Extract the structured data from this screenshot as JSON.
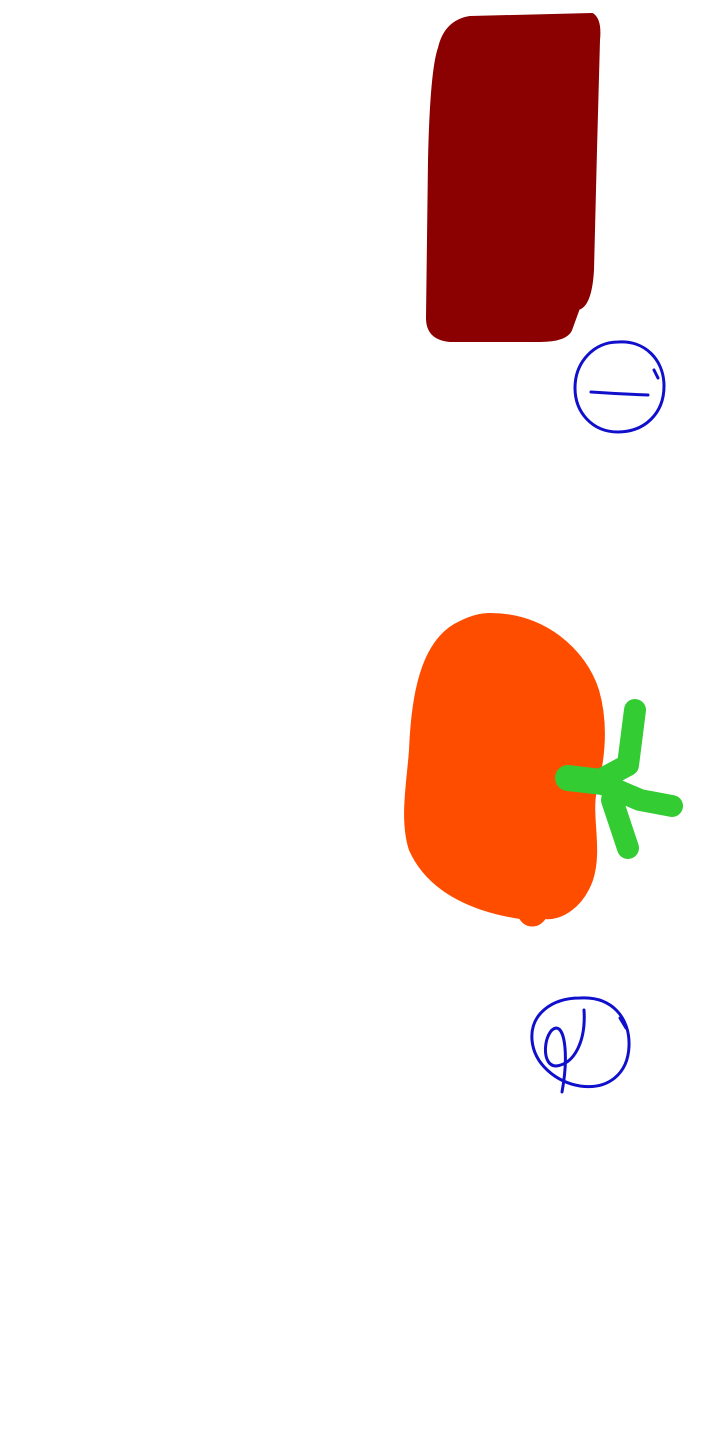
{
  "colors": {
    "background": "#ffffff",
    "dark_red": "#8b0000",
    "orange": "#ff4d00",
    "green": "#33cc33",
    "blue": "#1010cc"
  },
  "drawings": [
    {
      "name": "dark-red-rectangle-drawing",
      "color": "dark_red"
    },
    {
      "name": "minus-circle-drawing",
      "color": "blue"
    },
    {
      "name": "orange-fruit-drawing",
      "color": "orange"
    },
    {
      "name": "green-stem-drawing",
      "color": "green"
    },
    {
      "name": "scribbled-circle-drawing",
      "color": "blue"
    }
  ]
}
